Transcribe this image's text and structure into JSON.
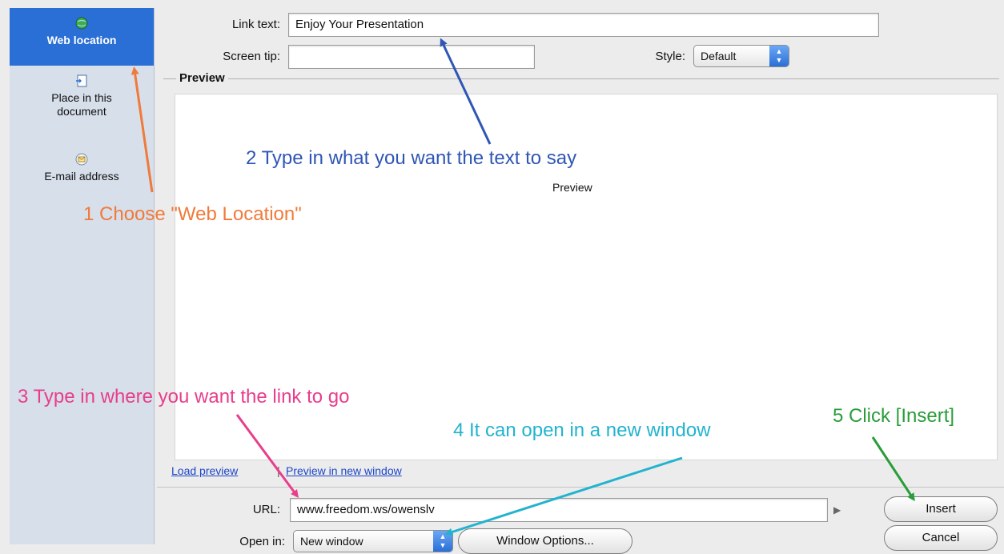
{
  "sidebar": {
    "items": [
      {
        "label": "Web location",
        "icon": "globe-icon",
        "selected": true
      },
      {
        "label": "Place in this document",
        "icon": "document-icon",
        "selected": false
      },
      {
        "label": "E-mail address",
        "icon": "email-icon",
        "selected": false
      }
    ]
  },
  "form": {
    "link_text_label": "Link text:",
    "link_text_value": "Enjoy Your Presentation",
    "screen_tip_label": "Screen tip:",
    "screen_tip_value": "",
    "style_label": "Style:",
    "style_value": "Default",
    "url_label": "URL:",
    "url_value": "www.freedom.ws/owenslv",
    "open_in_label": "Open in:",
    "open_in_value": "New window"
  },
  "preview": {
    "title": "Preview",
    "placeholder": "Preview",
    "load_link": "Load preview",
    "separator": "|",
    "new_window_link": "Preview in new window"
  },
  "buttons": {
    "window_options": "Window Options...",
    "insert": "Insert",
    "cancel": "Cancel"
  },
  "annotations": {
    "step1": "1 Choose \"Web Location\"",
    "step2": "2 Type in what you want the text to say",
    "step3": "3 Type in where you want the link to go",
    "step4": "4 It can open in a new window",
    "step5": "5 Click [Insert]"
  },
  "colors": {
    "step1": "#f07a3a",
    "step2": "#2f56b5",
    "step3": "#e83e8c",
    "step4": "#22b3cf",
    "step5": "#2a9d3a",
    "selected": "#2a6fd6"
  }
}
